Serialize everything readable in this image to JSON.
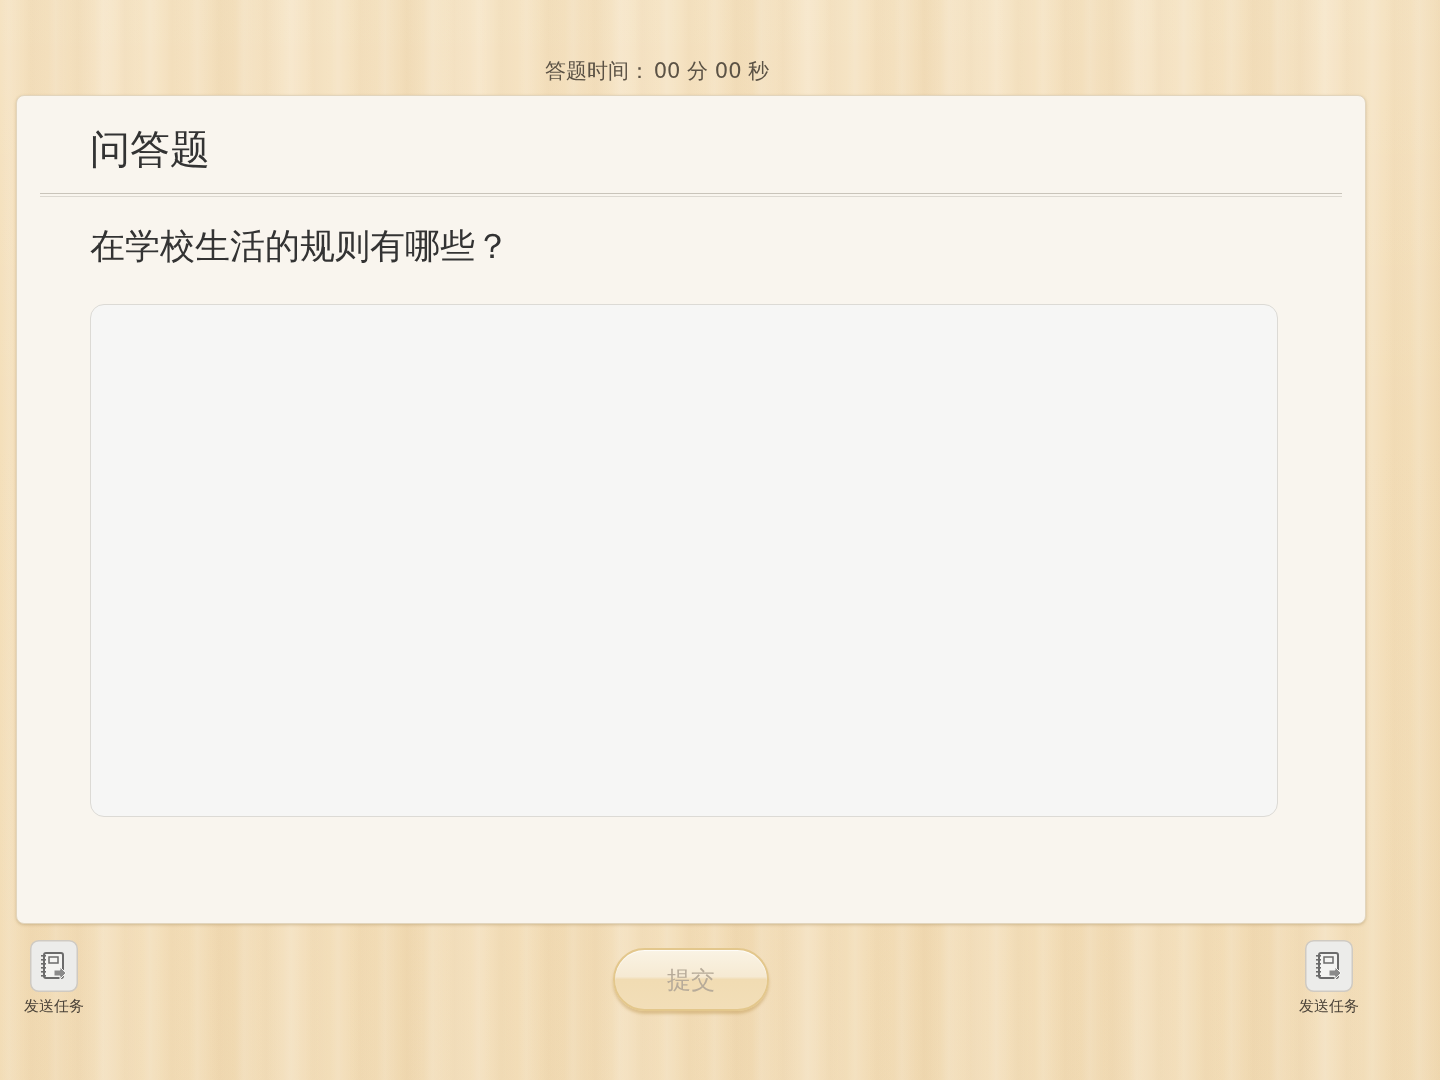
{
  "timer": {
    "label": "答题时间：",
    "value": "00 分 00 秒"
  },
  "question": {
    "type": "问答题",
    "text": "在学校生活的规则有哪些？"
  },
  "side_buttons": [
    {
      "label": "发送任务"
    },
    {
      "label": "发送任务"
    }
  ],
  "submit_button": {
    "label": "提交",
    "disabled": true
  }
}
